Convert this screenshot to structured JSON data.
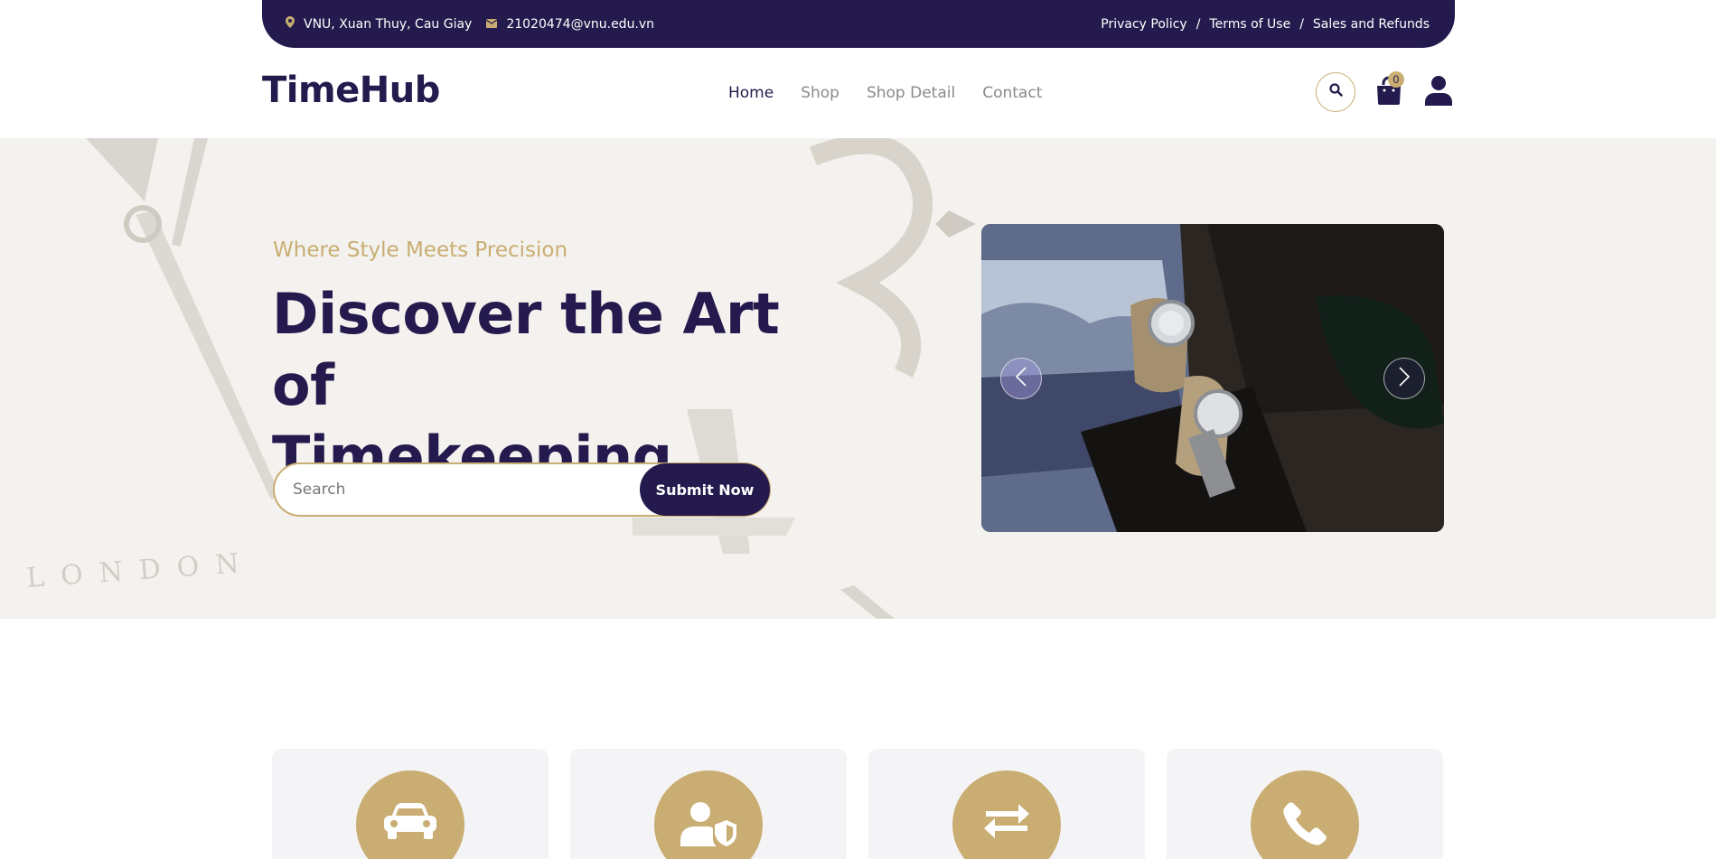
{
  "topbar": {
    "location": "VNU, Xuan Thuy, Cau Giay",
    "email": "21020474@vnu.edu.vn",
    "links": [
      "Privacy Policy",
      "Terms of Use",
      "Sales and Refunds"
    ],
    "separator": "/"
  },
  "nav": {
    "logo": "TimeHub",
    "items": [
      "Home",
      "Shop",
      "Shop Detail",
      "Contact"
    ],
    "active_item": "Home",
    "cart_count": "0"
  },
  "hero": {
    "tagline": "Where Style Meets Precision",
    "headline_line1": "Discover the Art of",
    "headline_line2": "Timekeeping",
    "search_placeholder": "Search",
    "submit_label": "Submit Now",
    "background_text": "LONDON"
  },
  "features": [
    {
      "icon": "car-icon"
    },
    {
      "icon": "user-shield-icon"
    },
    {
      "icon": "exchange-arrows-icon"
    },
    {
      "icon": "phone-icon"
    }
  ],
  "colors": {
    "primary": "#241a4d",
    "accent": "#c9ad72",
    "hero_bg": "#f4f2ee",
    "card_bg": "#f4f4f6"
  }
}
